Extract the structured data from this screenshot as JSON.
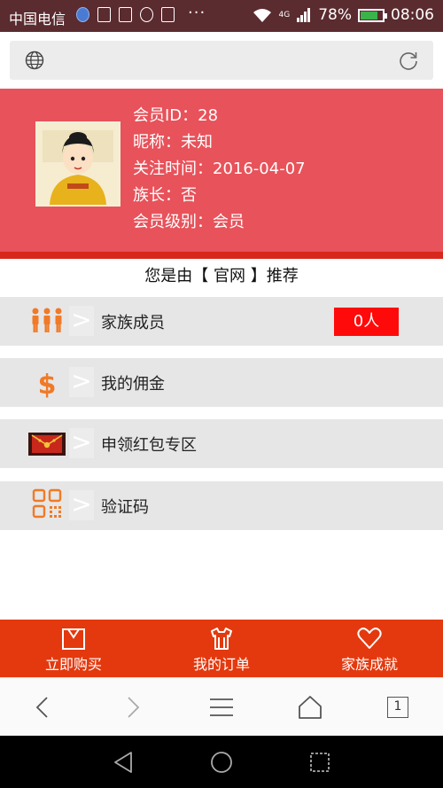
{
  "status_bar": {
    "carrier": "中国电信",
    "dots": "···",
    "network": "4G",
    "battery": "78%",
    "battery_level": 0.78,
    "time": "08:06"
  },
  "profile": {
    "member_id": "会员ID：28",
    "nickname": "昵称：未知",
    "follow_time": "关注时间：2016-04-07",
    "is_patriarch": "族长：否",
    "member_level": "会员级别：会员"
  },
  "referrer_text": "您是由【 官网 】推荐",
  "menu": [
    {
      "label": "家族成员",
      "icon": "people-icon",
      "badge": "0人"
    },
    {
      "label": "我的佣金",
      "icon": "dollar-icon"
    },
    {
      "label": "申领红包专区",
      "icon": "red-envelope-icon"
    },
    {
      "label": "验证码",
      "icon": "qr-code-icon"
    }
  ],
  "arrow": ">",
  "tabbar": [
    {
      "label": "立即购买",
      "icon": "shopping-bag-icon"
    },
    {
      "label": "我的订单",
      "icon": "shirt-icon"
    },
    {
      "label": "家族成就",
      "icon": "heart-icon"
    }
  ],
  "browser": {
    "tab_count": "1"
  },
  "colors": {
    "profile_bg": "#e8525a",
    "tabbar_bg": "#e4390e",
    "badge_bg": "#ff0a0a",
    "icon_orange": "#f07a28"
  }
}
